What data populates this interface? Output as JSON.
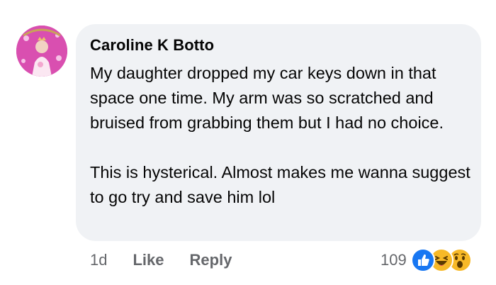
{
  "comment": {
    "author": "Caroline K Botto",
    "paragraphs": [
      "My daughter dropped my car keys down in that space one time. My arm was so scratched and bruised from grabbing them but I had no choice.",
      "This is hysterical. Almost makes me wanna suggest to go try and save him lol"
    ],
    "time": "1d",
    "like_label": "Like",
    "reply_label": "Reply",
    "reaction_count": "109",
    "reactions": [
      "like-icon",
      "haha-icon",
      "wow-icon"
    ]
  },
  "colors": {
    "bubble": "#f0f2f5",
    "meta_text": "#65676b",
    "like_blue": "#1877f2",
    "emoji_yellow": "#f7b928"
  }
}
